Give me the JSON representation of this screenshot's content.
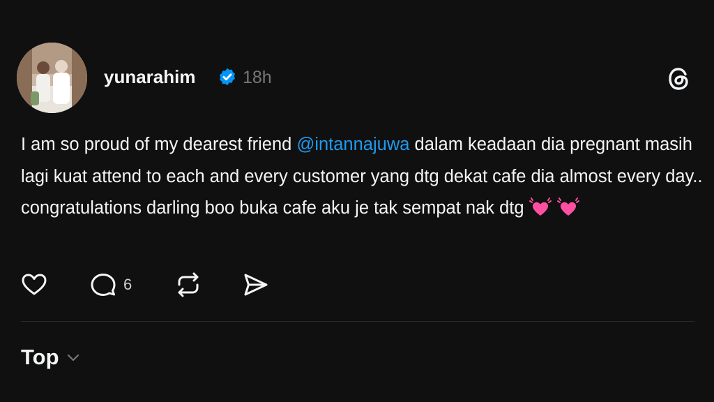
{
  "post": {
    "username": "yunarahim",
    "timestamp": "18h",
    "text_before": "I am so proud of my dearest friend ",
    "mention": "@intannajuwa",
    "text_after": " dalam keadaan dia pregnant masih lagi kuat attend to each and every customer yang dtg dekat cafe dia almost every day.. congratulations darling boo buka cafe aku je tak sempat nak dtg",
    "emojis": [
      "💓",
      "💓"
    ]
  },
  "actions": {
    "reply_count": "6",
    "icons": [
      "heart-icon",
      "comment-icon",
      "repost-icon",
      "share-icon"
    ]
  },
  "sort": {
    "label": "Top"
  },
  "colors": {
    "background": "#101010",
    "text": "#f3f5f7",
    "secondary": "#777777",
    "mention": "#1d9bf0",
    "verified": "#0095f6"
  }
}
